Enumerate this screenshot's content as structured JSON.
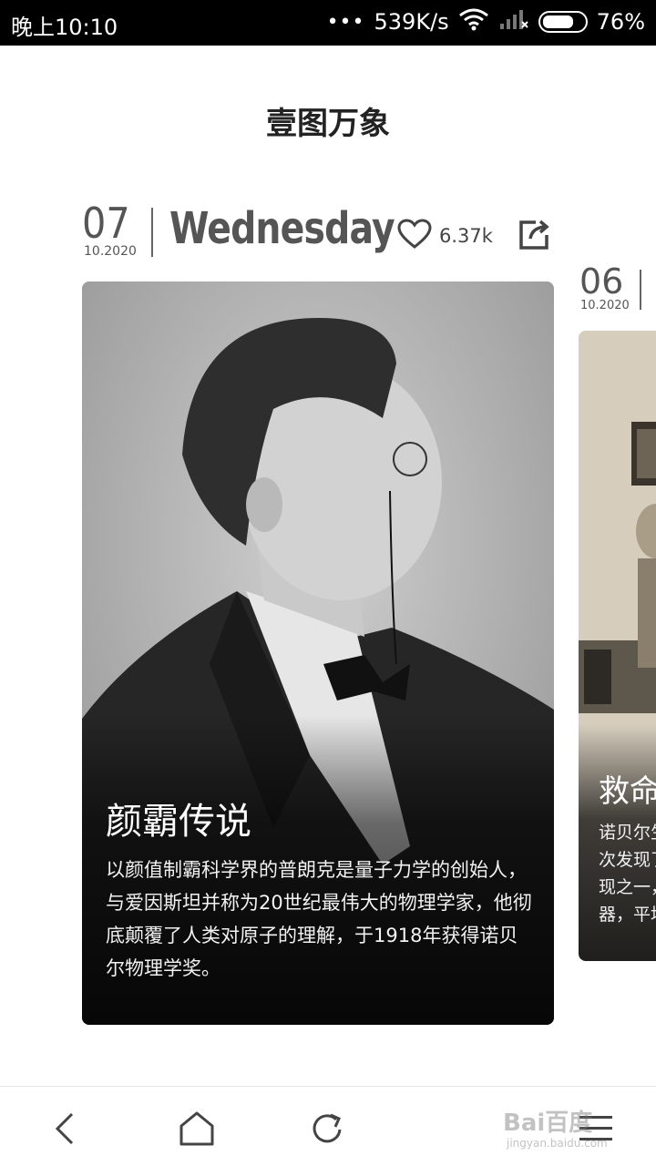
{
  "status_bar": {
    "time": "晚上10:10",
    "dots": "•••",
    "network_speed": "539K/s",
    "battery_percent": "76%",
    "battery_level": 0.76
  },
  "page": {
    "title": "壹图万象"
  },
  "cards": [
    {
      "day": "07",
      "month_year": "10.2020",
      "weekday": "Wednesday",
      "likes": "6.37k",
      "title": "颜霸传说",
      "description": "以颜值制霸科学界的普朗克是量子力学的创始人，与爱因斯坦并称为20世纪最伟大的物理学家，他彻底颠覆了人类对原子的理解，于1918年获得诺贝尔物理学奖。"
    },
    {
      "day": "06",
      "month_year": "10.2020",
      "title": "救命",
      "description_lines": [
        "诺贝尔生",
        "次发现了",
        "现之一，",
        "器，平均"
      ]
    }
  ],
  "watermark": {
    "text": "Bai百度",
    "sub": "jingyan.baidu.com"
  },
  "icons": {
    "wifi": "wifi-icon",
    "signal": "signal-icon",
    "battery": "battery-icon",
    "heart": "heart-icon",
    "share": "share-icon",
    "back": "back-icon",
    "home": "home-icon",
    "refresh": "refresh-icon",
    "menu": "menu-icon"
  }
}
